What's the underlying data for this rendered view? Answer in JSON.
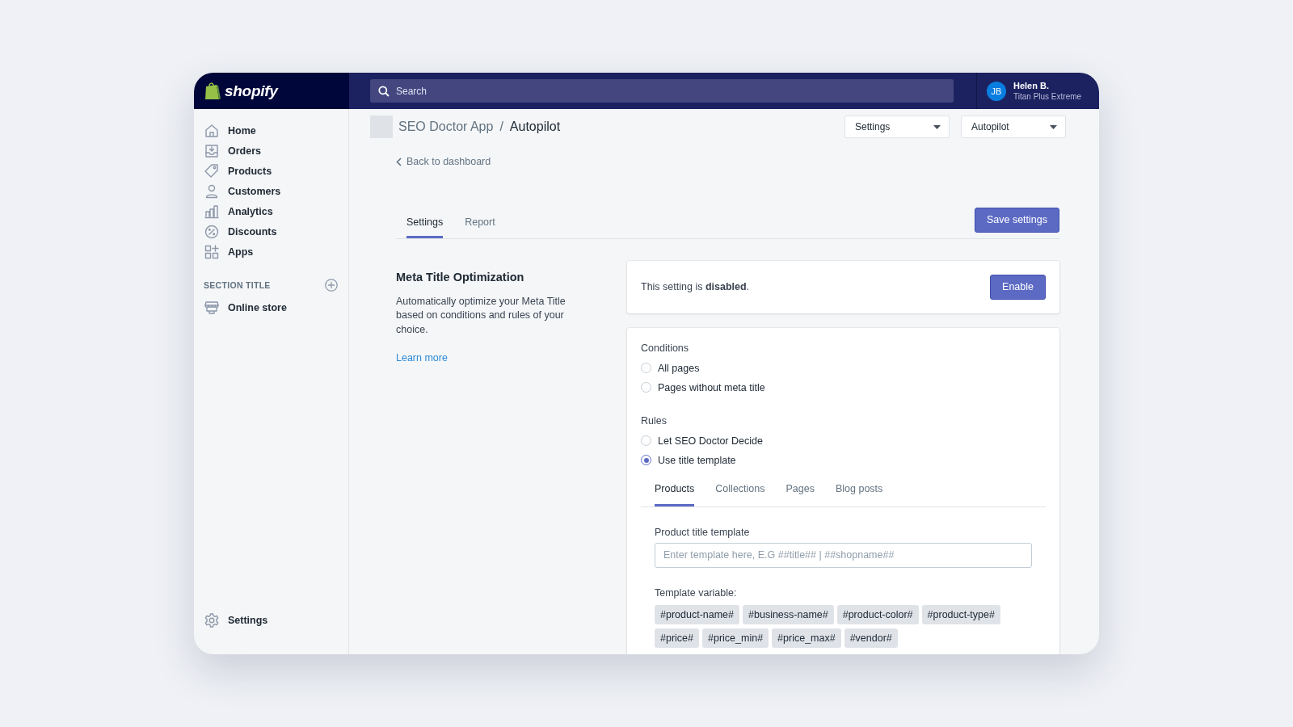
{
  "topbar": {
    "logo": "shopify",
    "search": {
      "placeholder": "Search"
    },
    "user": {
      "initials": "JB",
      "name": "Helen B.",
      "plan": "Titan Plus Extreme"
    }
  },
  "sidebar": {
    "items": [
      "Home",
      "Orders",
      "Products",
      "Customers",
      "Analytics",
      "Discounts",
      "Apps"
    ],
    "section": {
      "title": "SECTION TITLE",
      "items": [
        "Online store"
      ]
    },
    "footer": "Settings"
  },
  "header": {
    "breadcrumb": [
      {
        "label": "SEO Doctor App",
        "current": false
      },
      {
        "label": "Autopilot",
        "current": true
      }
    ],
    "separator": "/",
    "dropdowns": [
      "Settings",
      "Autopilot"
    ]
  },
  "back_link": "Back to dashboard",
  "tabs": [
    {
      "label": "Settings",
      "selected": true
    },
    {
      "label": "Report",
      "selected": false
    }
  ],
  "save_button": "Save settings",
  "section": {
    "title": "Meta Title Optimization",
    "description": "Automatically optimize your Meta Title based on conditions and rules of your choice.",
    "link": "Learn more"
  },
  "status_card": {
    "text": "This setting is **disabled**.",
    "button": "Enable"
  },
  "conditions": {
    "label": "Conditions",
    "options": [
      {
        "label": "All pages",
        "selected": false
      },
      {
        "label": "Pages without meta title",
        "selected": false
      }
    ]
  },
  "rules": {
    "label": "Rules",
    "options": [
      {
        "label": "Let SEO Doctor Decide",
        "selected": false
      },
      {
        "label": "Use title template",
        "selected": true
      }
    ]
  },
  "template_tabs": [
    {
      "label": "Products",
      "selected": true
    },
    {
      "label": "Collections",
      "selected": false
    },
    {
      "label": "Pages",
      "selected": false
    },
    {
      "label": "Blog posts",
      "selected": false
    }
  ],
  "template_field": {
    "label": "Product title template",
    "placeholder": "Enter template here, E.G ##title## | ##shopname##"
  },
  "variables": {
    "label": "Template variable:",
    "tags": [
      "#product-name#",
      "#business-name#",
      "#product-color#",
      "#product-type#",
      "#price#",
      "#price_min#",
      "#price_max#",
      "#vendor#"
    ]
  }
}
